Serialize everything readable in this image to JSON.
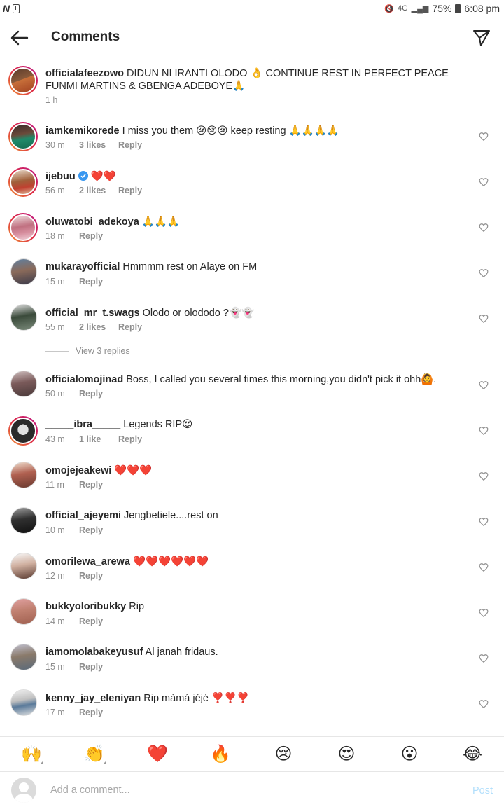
{
  "status_bar": {
    "battery": "75%",
    "time": "6:08 pm",
    "network": "4G"
  },
  "header": {
    "title": "Comments"
  },
  "caption": {
    "username": "officialafeezowo",
    "text": "DIDUN NI IRANTI OLODO 👌 CONTINUE REST IN PERFECT PEACE FUNMI MARTINS & GBENGA ADEBOYE🙏",
    "time": "1 h"
  },
  "comments": [
    {
      "username": "iamkemikorede",
      "text": "I miss you them 😢😢😢 keep resting 🙏🙏🙏🙏",
      "time": "30 m",
      "likes": "3 likes",
      "reply": "Reply"
    },
    {
      "username": "ijebuu",
      "verified": true,
      "text": "❤️❤️",
      "time": "56 m",
      "likes": "2 likes",
      "reply": "Reply"
    },
    {
      "username": "oluwatobi_adekoya",
      "text": "🙏🙏🙏",
      "time": "18 m",
      "likes": "",
      "reply": "Reply"
    },
    {
      "username": "mukarayofficial",
      "text": "Hmmmm rest on  Alaye on FM",
      "time": "15 m",
      "likes": "",
      "reply": "Reply"
    },
    {
      "username": "official_mr_t.swags",
      "text": "Olodo or olododo ?👻👻",
      "time": "55 m",
      "likes": "2 likes",
      "reply": "Reply"
    },
    {
      "username": "officialomojinad",
      "text": "Boss, I called you several times this morning,you didn't pick it ohh🙆.",
      "time": "50 m",
      "likes": "",
      "reply": "Reply"
    },
    {
      "username": "_____ibra_____",
      "text": "Legends RIP😍",
      "time": "43 m",
      "likes": "1 like",
      "reply": "Reply"
    },
    {
      "username": "omojejeakewi",
      "text": "❤️❤️❤️",
      "time": "11 m",
      "likes": "",
      "reply": "Reply"
    },
    {
      "username": "official_ajeyemi",
      "text": "Jengbetiele....rest on",
      "time": "10 m",
      "likes": "",
      "reply": "Reply"
    },
    {
      "username": "omorilewa_arewa",
      "text": "❤️❤️❤️❤️❤️❤️",
      "time": "12 m",
      "likes": "",
      "reply": "Reply"
    },
    {
      "username": "bukkyoloribukky",
      "text": "Rip",
      "time": "14 m",
      "likes": "",
      "reply": "Reply"
    },
    {
      "username": "iamomolabakeyusuf",
      "text": "Al janah fridaus.",
      "time": "15 m",
      "likes": "",
      "reply": "Reply"
    },
    {
      "username": "kenny_jay_eleniyan",
      "text": "Rip màmá jéjé ❣️❣️❣️",
      "time": "17 m",
      "likes": "",
      "reply": "Reply"
    }
  ],
  "view_replies": "View 3 replies",
  "emoji_bar": [
    "🙌",
    "👏",
    "❤️",
    "🔥",
    "😢",
    "😍",
    "😮",
    "😂"
  ],
  "input": {
    "placeholder": "Add a comment...",
    "post_label": "Post"
  },
  "colors": {
    "accent": "#0095f6",
    "post_disabled": "#b2dffc",
    "meta_gray": "#8e8e8e",
    "heart_red": "#ed4956"
  }
}
